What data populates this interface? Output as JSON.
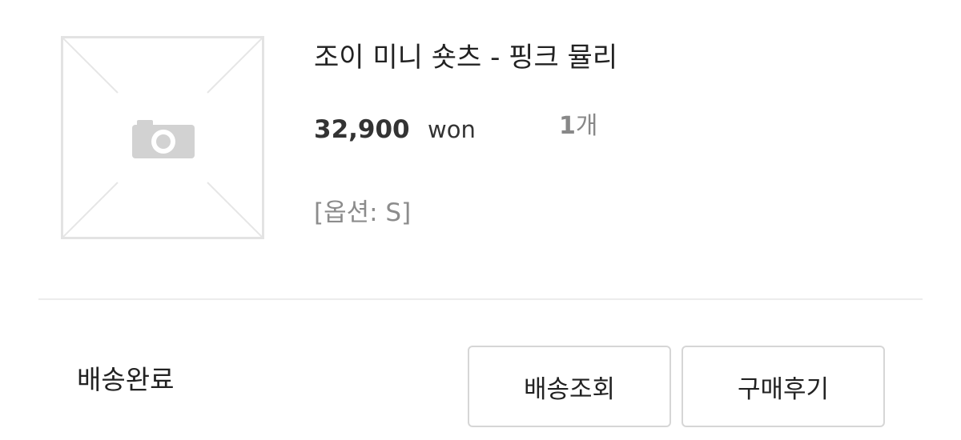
{
  "product": {
    "title": "조이 미니 숏츠 - 핑크 뮬리",
    "price_amount": "32,900",
    "price_unit": "won",
    "quantity_number": "1",
    "quantity_unit": "개",
    "option": "[옵션: S]",
    "thumbnail_icon": "camera-placeholder-icon"
  },
  "order": {
    "status": "배송완료",
    "track_label": "배송조회",
    "review_label": "구매후기"
  },
  "colors": {
    "text": "#222222",
    "muted": "#888888",
    "border": "#d6d6d6",
    "divider": "#ececec"
  }
}
